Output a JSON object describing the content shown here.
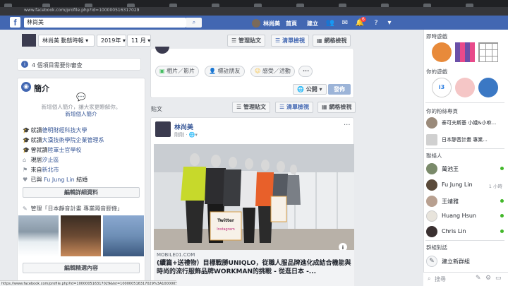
{
  "browser": {
    "url": "www.facebook.com/profile.php?id=100000516317029"
  },
  "fb": {
    "logo": "f",
    "search_value": "林尚美",
    "profile_name": "林尚美",
    "nav_home": "首頁",
    "nav_create": "建立",
    "notif_count": "6"
  },
  "subnav": {
    "filter": "林尚美 動態時報",
    "year": "2019年",
    "month": "11 月",
    "manage": "管理貼文",
    "list_view": "清單檢視",
    "grid_view": "網格檢視"
  },
  "pending": {
    "text": "4 個項目需要你審查"
  },
  "intro": {
    "title": "簡介",
    "prompt": "新增個人簡介，讓大家更瞭解你。",
    "add_link": "新增個人簡介",
    "items": [
      {
        "icon": "🎓",
        "pre": "就讀",
        "link": "德明財經科技大學",
        "post": ""
      },
      {
        "icon": "🎓",
        "pre": "就讀",
        "link": "大漢技術學院企業管理系",
        "post": ""
      },
      {
        "icon": "🎓",
        "pre": "曾就讀",
        "link": "陸軍士官學校",
        "post": ""
      },
      {
        "icon": "⌂",
        "pre": "現居",
        "link": "汐止區",
        "post": ""
      },
      {
        "icon": "⚑",
        "pre": "來自",
        "link": "新北市",
        "post": ""
      },
      {
        "icon": "♥",
        "pre": "已與 ",
        "link": "Fu Jung Lin",
        "post": " 結婚"
      }
    ],
    "edit_details": "編輯詳細資料",
    "featured": "管理「日本靜音計畫 專業隔音膠條」",
    "edit_featured": "編輯精選內容"
  },
  "composer": {
    "photo": "相片／影片",
    "tag": "標註朋友",
    "feeling": "感受／活動",
    "privacy": "公開",
    "post": "發佈"
  },
  "posts_bar": {
    "title": "貼文",
    "manage": "管理貼文",
    "list_view": "清單檢視",
    "grid_view": "網格檢視"
  },
  "post": {
    "author": "林尚美",
    "time": "剛剛",
    "domain": "MOBILE01.COM",
    "title": "(續篇+送禮物）目標戰勝UNIQLO，從職人服品牌進化成結合機能與時尚的流行服飾品牌WORKMAN的挑戰 - 從逛日本 -...",
    "sign1": "Twitter",
    "sign2": "Instagram"
  },
  "right": {
    "games_title": "即時遊戲",
    "your_games": "你的遊戲",
    "fanpages_title": "你的粉絲專頁",
    "fanpages": [
      "泰可夫斯基 小娥&小咻...",
      "日本靜音計畫 專業..."
    ],
    "contacts_title": "聯絡人",
    "contacts": [
      {
        "name": "萬池王",
        "time": ""
      },
      {
        "name": "Fu Jung Lin",
        "time": "1 小時"
      },
      {
        "name": "王靖雅",
        "time": ""
      },
      {
        "name": "Huang Hsun",
        "time": ""
      },
      {
        "name": "Chris Lin",
        "time": ""
      }
    ],
    "groups_title": "群組對話",
    "new_group": "建立新群組",
    "search_placeholder": "搜尋"
  },
  "statusbar": "https://www.facebook.com/profile.php?id=100000516317029&lst=100000516317029%3A100000516317029%3A1575278532"
}
